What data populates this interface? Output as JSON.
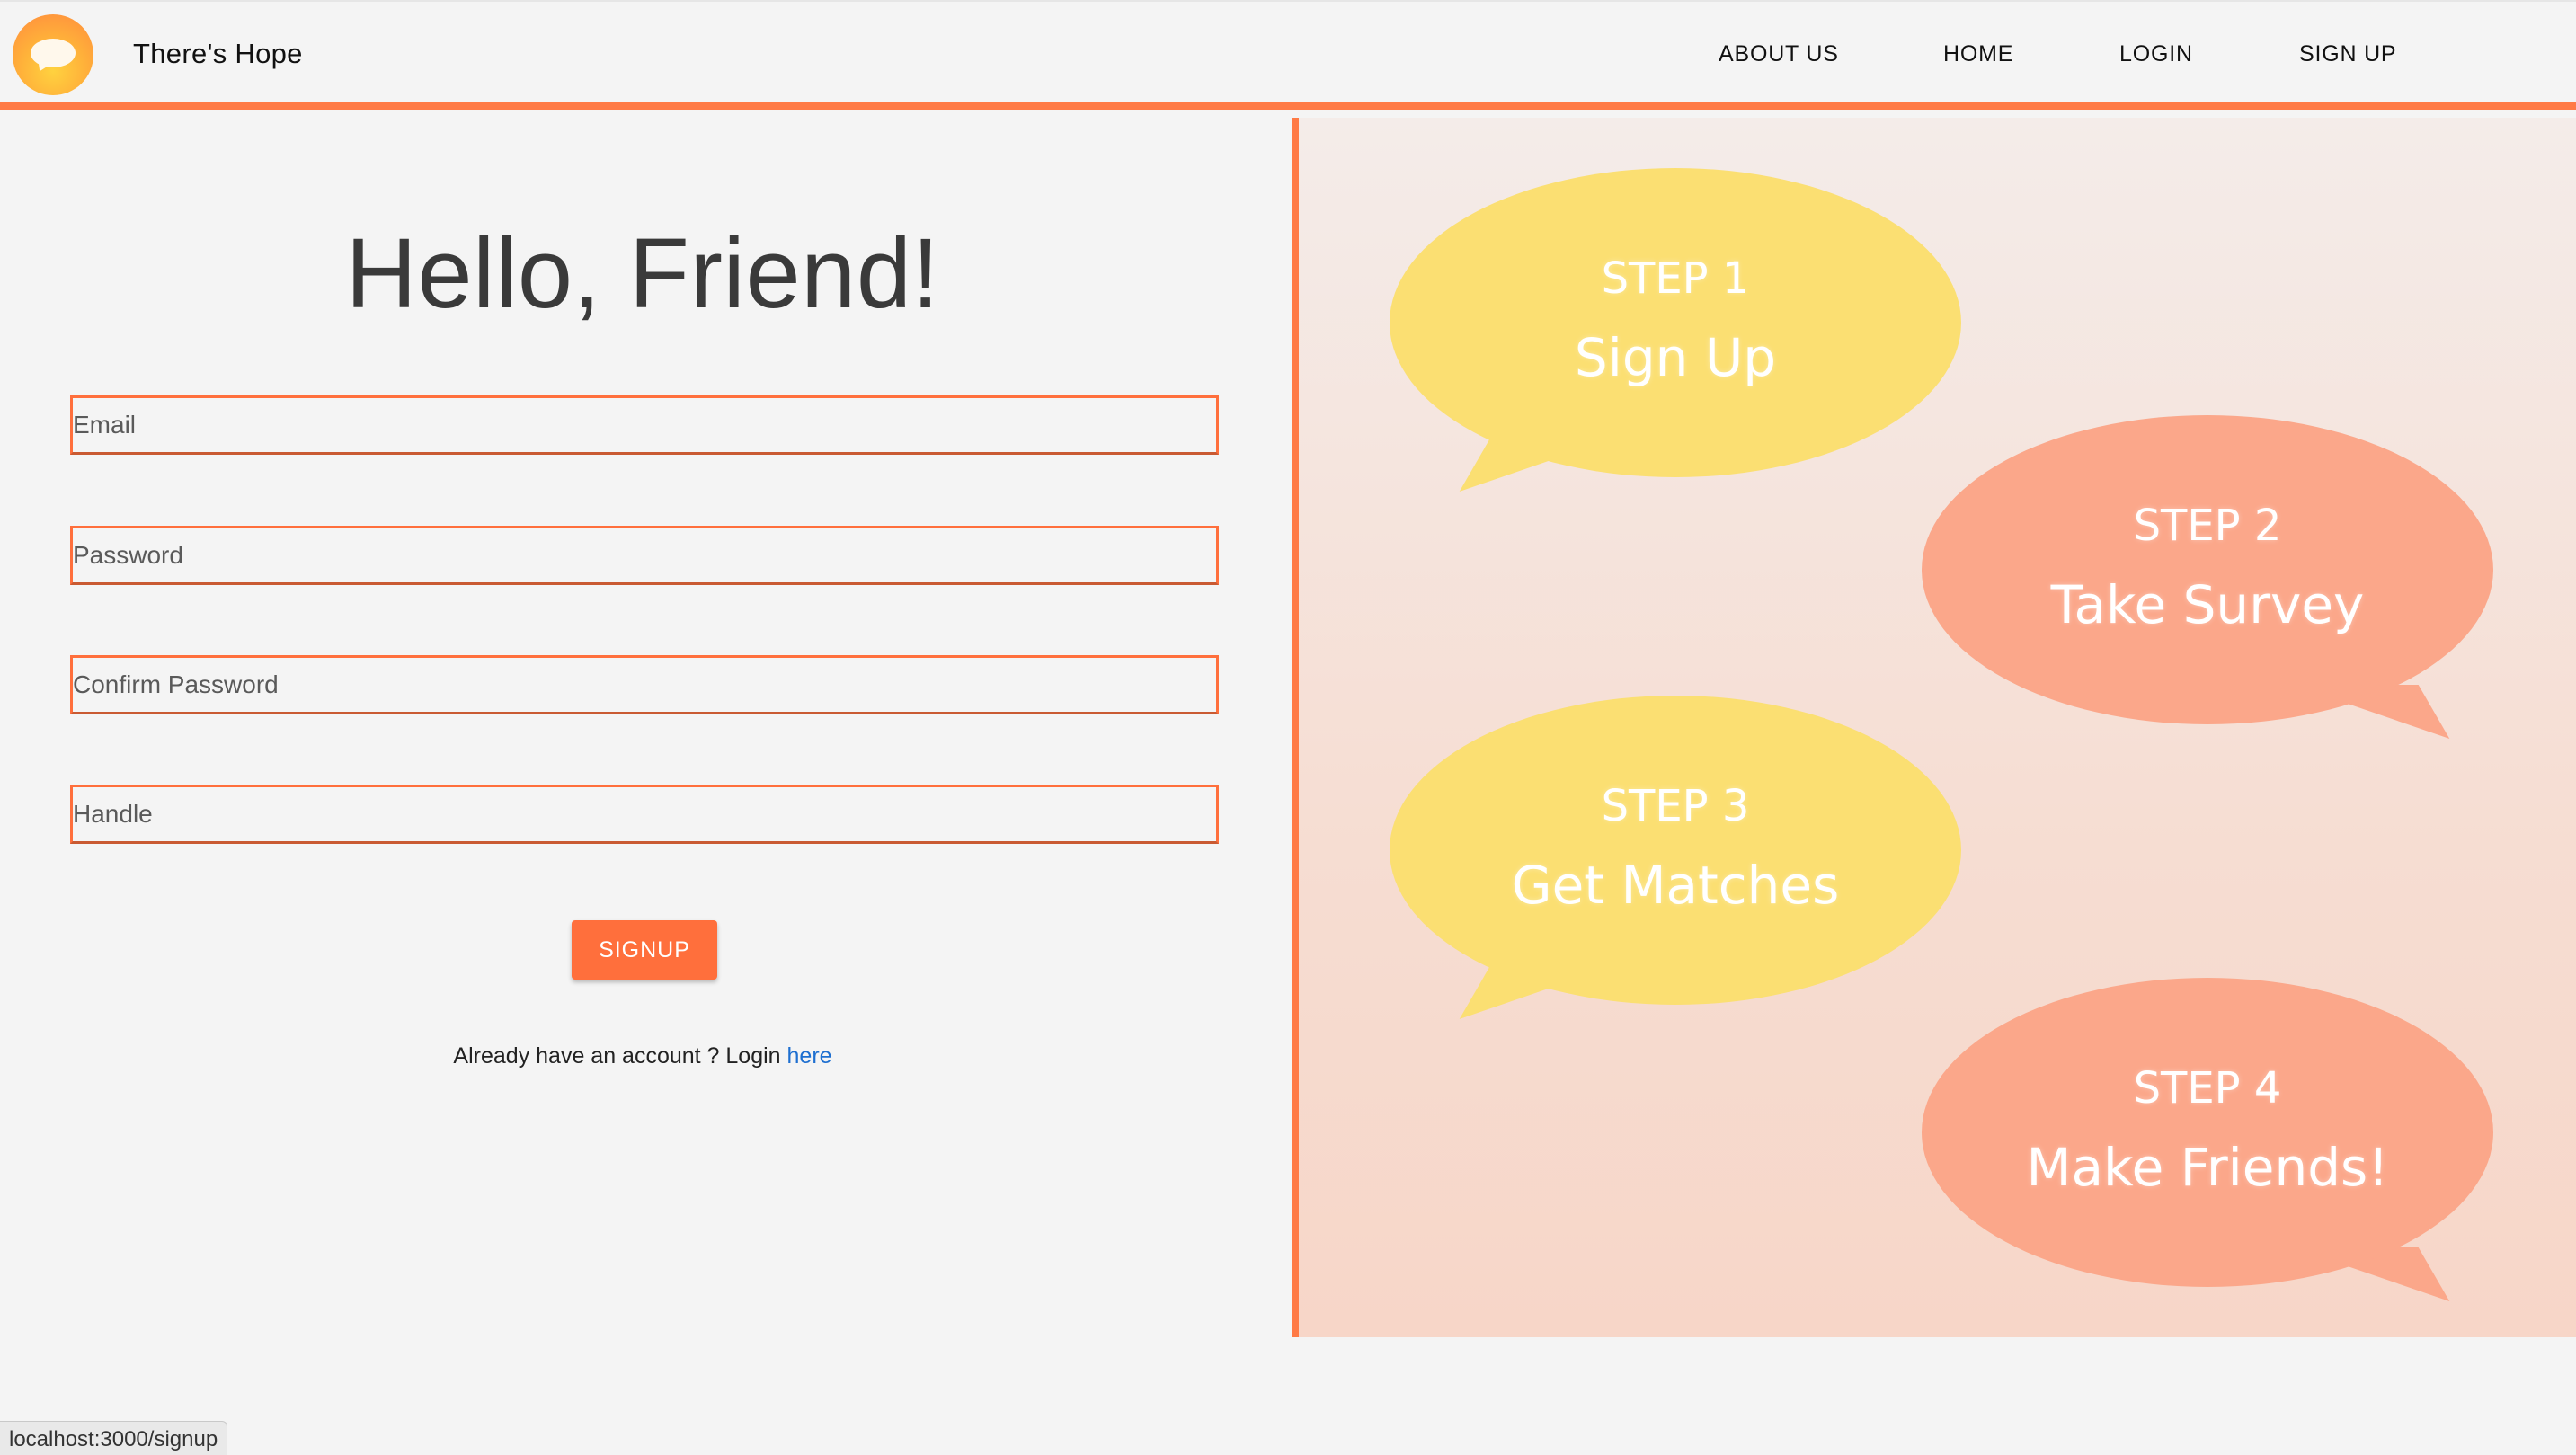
{
  "header": {
    "brand": "There's Hope",
    "nav": {
      "about": "ABOUT US",
      "home": "HOME",
      "login": "LOGIN",
      "signup": "SIGN UP"
    },
    "accent_color": "#ff7a45"
  },
  "form": {
    "title": "Hello, Friend!",
    "email_placeholder": "Email",
    "password_placeholder": "Password",
    "confirm_placeholder": "Confirm Password",
    "handle_placeholder": "Handle",
    "submit_label": "SIGNUP",
    "login_prompt": "Already have an account ? Login ",
    "login_link": "here"
  },
  "steps": [
    {
      "num": "STEP 1",
      "text": "Sign Up",
      "color": "#fbdf72"
    },
    {
      "num": "STEP 2",
      "text": "Take Survey",
      "color": "#fba78a"
    },
    {
      "num": "STEP 3",
      "text": "Get Matches",
      "color": "#fbdf72"
    },
    {
      "num": "STEP 4",
      "text": "Make Friends!",
      "color": "#fba78a"
    }
  ],
  "status_bar": {
    "url": "localhost:3000/signup"
  }
}
